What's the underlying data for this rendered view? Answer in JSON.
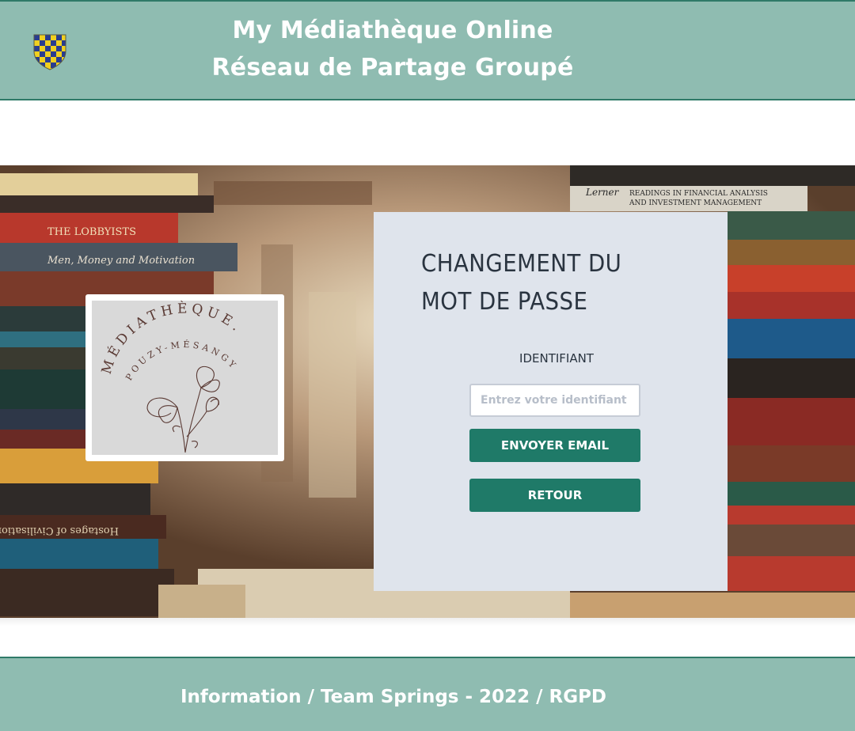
{
  "header": {
    "title_line1": "My Médiathèque Online",
    "title_line2": "Réseau de Partage Groupé"
  },
  "logo": {
    "text_top": "MÉDIATHÈQUE.",
    "text_bottom": "POUZY-MÉSANGY"
  },
  "form": {
    "title_line1": "CHANGEMENT DU",
    "title_line2": "MOT DE PASSE",
    "id_label": "IDENTIFIANT",
    "id_placeholder": "Entrez votre identifiant",
    "id_value": "",
    "send_button": "ENVOYER EMAIL",
    "back_button": "RETOUR"
  },
  "footer": {
    "text": "Information / Team Springs - 2022 / RGPD"
  },
  "colors": {
    "header_bg": "#8fbcb1",
    "border": "#2f7a68",
    "button": "#1f7a68",
    "panel_bg": "#dfe4ec"
  }
}
